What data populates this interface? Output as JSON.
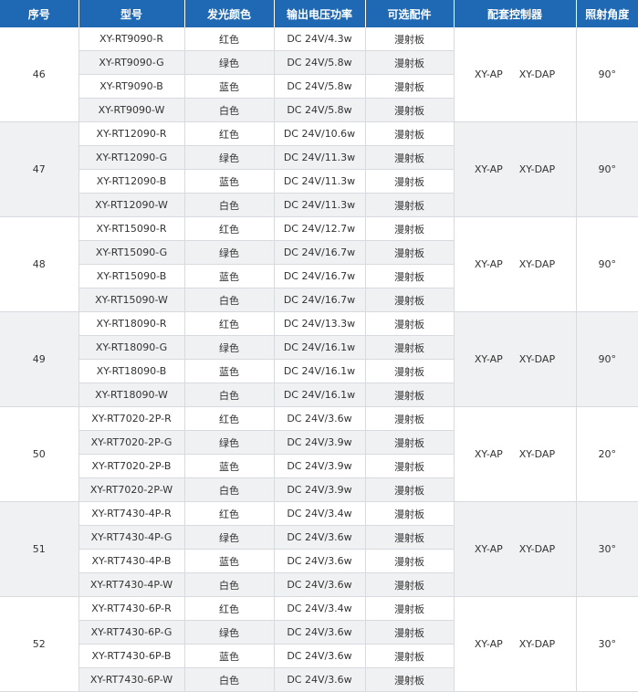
{
  "headers": [
    "序号",
    "型号",
    "发光颜色",
    "输出电压功率",
    "可选配件",
    "配套控制器",
    "照射角度"
  ],
  "groups": [
    {
      "seq": "46",
      "controller": [
        "XY-AP",
        "XY-DAP"
      ],
      "angle": "90°",
      "rows": [
        {
          "model": "XY-RT9090-R",
          "color": "红色",
          "power": "DC 24V/4.3w",
          "accessory": "漫射板"
        },
        {
          "model": "XY-RT9090-G",
          "color": "绿色",
          "power": "DC 24V/5.8w",
          "accessory": "漫射板"
        },
        {
          "model": "XY-RT9090-B",
          "color": "蓝色",
          "power": "DC 24V/5.8w",
          "accessory": "漫射板"
        },
        {
          "model": "XY-RT9090-W",
          "color": "白色",
          "power": "DC 24V/5.8w",
          "accessory": "漫射板"
        }
      ]
    },
    {
      "seq": "47",
      "controller": [
        "XY-AP",
        "XY-DAP"
      ],
      "angle": "90°",
      "rows": [
        {
          "model": "XY-RT12090-R",
          "color": "红色",
          "power": "DC 24V/10.6w",
          "accessory": "漫射板"
        },
        {
          "model": "XY-RT12090-G",
          "color": "绿色",
          "power": "DC 24V/11.3w",
          "accessory": "漫射板"
        },
        {
          "model": "XY-RT12090-B",
          "color": "蓝色",
          "power": "DC 24V/11.3w",
          "accessory": "漫射板"
        },
        {
          "model": "XY-RT12090-W",
          "color": "白色",
          "power": "DC 24V/11.3w",
          "accessory": "漫射板"
        }
      ]
    },
    {
      "seq": "48",
      "controller": [
        "XY-AP",
        "XY-DAP"
      ],
      "angle": "90°",
      "rows": [
        {
          "model": "XY-RT15090-R",
          "color": "红色",
          "power": "DC 24V/12.7w",
          "accessory": "漫射板"
        },
        {
          "model": "XY-RT15090-G",
          "color": "绿色",
          "power": "DC 24V/16.7w",
          "accessory": "漫射板"
        },
        {
          "model": "XY-RT15090-B",
          "color": "蓝色",
          "power": "DC 24V/16.7w",
          "accessory": "漫射板"
        },
        {
          "model": "XY-RT15090-W",
          "color": "白色",
          "power": "DC 24V/16.7w",
          "accessory": "漫射板"
        }
      ]
    },
    {
      "seq": "49",
      "controller": [
        "XY-AP",
        "XY-DAP"
      ],
      "angle": "90°",
      "rows": [
        {
          "model": "XY-RT18090-R",
          "color": "红色",
          "power": "DC 24V/13.3w",
          "accessory": "漫射板"
        },
        {
          "model": "XY-RT18090-G",
          "color": "绿色",
          "power": "DC 24V/16.1w",
          "accessory": "漫射板"
        },
        {
          "model": "XY-RT18090-B",
          "color": "蓝色",
          "power": "DC 24V/16.1w",
          "accessory": "漫射板"
        },
        {
          "model": "XY-RT18090-W",
          "color": "白色",
          "power": "DC 24V/16.1w",
          "accessory": "漫射板"
        }
      ]
    },
    {
      "seq": "50",
      "controller": [
        "XY-AP",
        "XY-DAP"
      ],
      "angle": "20°",
      "rows": [
        {
          "model": "XY-RT7020-2P-R",
          "color": "红色",
          "power": "DC 24V/3.6w",
          "accessory": "漫射板"
        },
        {
          "model": "XY-RT7020-2P-G",
          "color": "绿色",
          "power": "DC 24V/3.9w",
          "accessory": "漫射板"
        },
        {
          "model": "XY-RT7020-2P-B",
          "color": "蓝色",
          "power": "DC 24V/3.9w",
          "accessory": "漫射板"
        },
        {
          "model": "XY-RT7020-2P-W",
          "color": "白色",
          "power": "DC 24V/3.9w",
          "accessory": "漫射板"
        }
      ]
    },
    {
      "seq": "51",
      "controller": [
        "XY-AP",
        "XY-DAP"
      ],
      "angle": "30°",
      "rows": [
        {
          "model": "XY-RT7430-4P-R",
          "color": "红色",
          "power": "DC 24V/3.4w",
          "accessory": "漫射板"
        },
        {
          "model": "XY-RT7430-4P-G",
          "color": "绿色",
          "power": "DC 24V/3.6w",
          "accessory": "漫射板"
        },
        {
          "model": "XY-RT7430-4P-B",
          "color": "蓝色",
          "power": "DC 24V/3.6w",
          "accessory": "漫射板"
        },
        {
          "model": "XY-RT7430-4P-W",
          "color": "白色",
          "power": "DC 24V/3.6w",
          "accessory": "漫射板"
        }
      ]
    },
    {
      "seq": "52",
      "controller": [
        "XY-AP",
        "XY-DAP"
      ],
      "angle": "30°",
      "rows": [
        {
          "model": "XY-RT7430-6P-R",
          "color": "红色",
          "power": "DC 24V/3.4w",
          "accessory": "漫射板"
        },
        {
          "model": "XY-RT7430-6P-G",
          "color": "绿色",
          "power": "DC 24V/3.6w",
          "accessory": "漫射板"
        },
        {
          "model": "XY-RT7430-6P-B",
          "color": "蓝色",
          "power": "DC 24V/3.6w",
          "accessory": "漫射板"
        },
        {
          "model": "XY-RT7430-6P-W",
          "color": "白色",
          "power": "DC 24V/3.6w",
          "accessory": "漫射板"
        }
      ]
    }
  ]
}
